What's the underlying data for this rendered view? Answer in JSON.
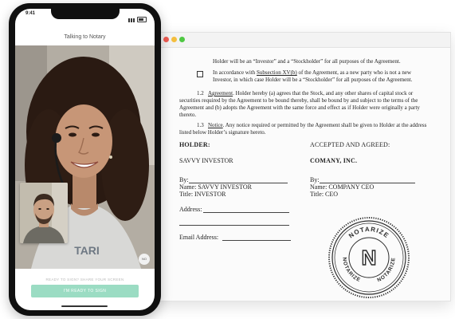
{
  "phone": {
    "status_time": "9:41",
    "app_title": "Talking to Notary",
    "prompt": "READY TO SIGN? SHARE YOUR SCREEN",
    "cta_label": "I'M READY TO SIGN",
    "badge": "NO"
  },
  "document": {
    "p1": "Holder will be an “Investor” and a “Stockholder” for all purposes of the Agreement.",
    "p2_a": "In accordance with ",
    "p2_link": "Subsection XV(b)",
    "p2_b": " of the Agreement, as a new party who is not a new Investor, in which case Holder will be a “Stockholder” for all purposes of the Agreement.",
    "s12_num": "1.2",
    "s12_title": "Agreement",
    "s12_text": ". Holder hereby (a) agrees that the Stock, and any other shares of capital stock or securities required by the Agreement to be bound thereby, shall be bound by and subject to the terms of the Agreement and (b) adopts the Agreement with the same force and effect as if Holder were originally a party thereto.",
    "s13_num": "1.3",
    "s13_title": "Notice",
    "s13_text": ". Any notice required or permitted by the Agreement shall be given to Holder at the address listed below Holder’s signature hereto.",
    "holder_heading": "HOLDER:",
    "holder_name": "SAVVY INVESTOR",
    "by_label": "By:",
    "holder_name_line": "Name: SAVVY INVESTOR",
    "holder_title_line": "Title: INVESTOR",
    "address_label": "Address:",
    "email_label": "Email Address:",
    "accepted_heading": "ACCEPTED AND AGREED:",
    "company_name": "COMANY, INC.",
    "company_by_label": "By:",
    "company_name_line": "Name: COMPANY CEO",
    "company_title_line": "Title: CEO",
    "seal_top": "NOTARIZE",
    "seal_right": "NOTARIZE",
    "seal_left": "NOTARIZE",
    "seal_letter": "N"
  },
  "colors": {
    "cta_green": "#9bdcc3",
    "window_red": "#ef5b52",
    "window_yellow": "#f4be3e",
    "window_green": "#4fc843"
  }
}
